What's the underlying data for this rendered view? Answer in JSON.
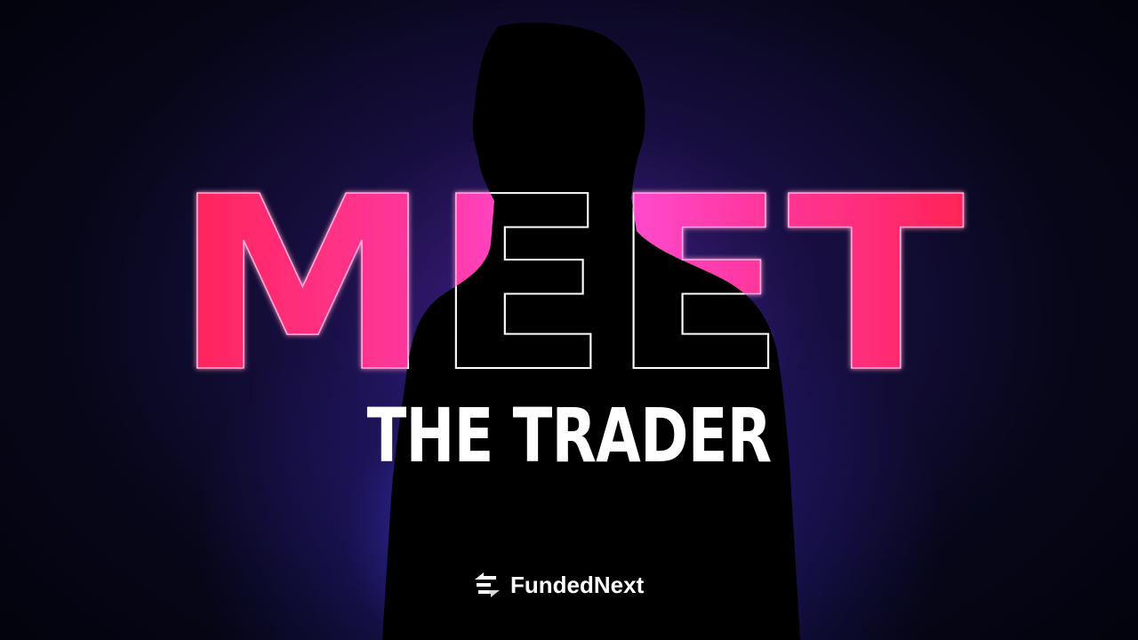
{
  "headline": {
    "word": "MEET"
  },
  "subtitle": {
    "text": "THE TRADER"
  },
  "brand": {
    "name": "FundedNext",
    "icon": "fundednext-logo-icon"
  },
  "colors": {
    "headline_gradient_start": "#ff2a55",
    "headline_gradient_mid": "#ff4fd8",
    "background_glow": "#5a50ff",
    "subtitle": "#ffffff",
    "silhouette": "#000000"
  }
}
